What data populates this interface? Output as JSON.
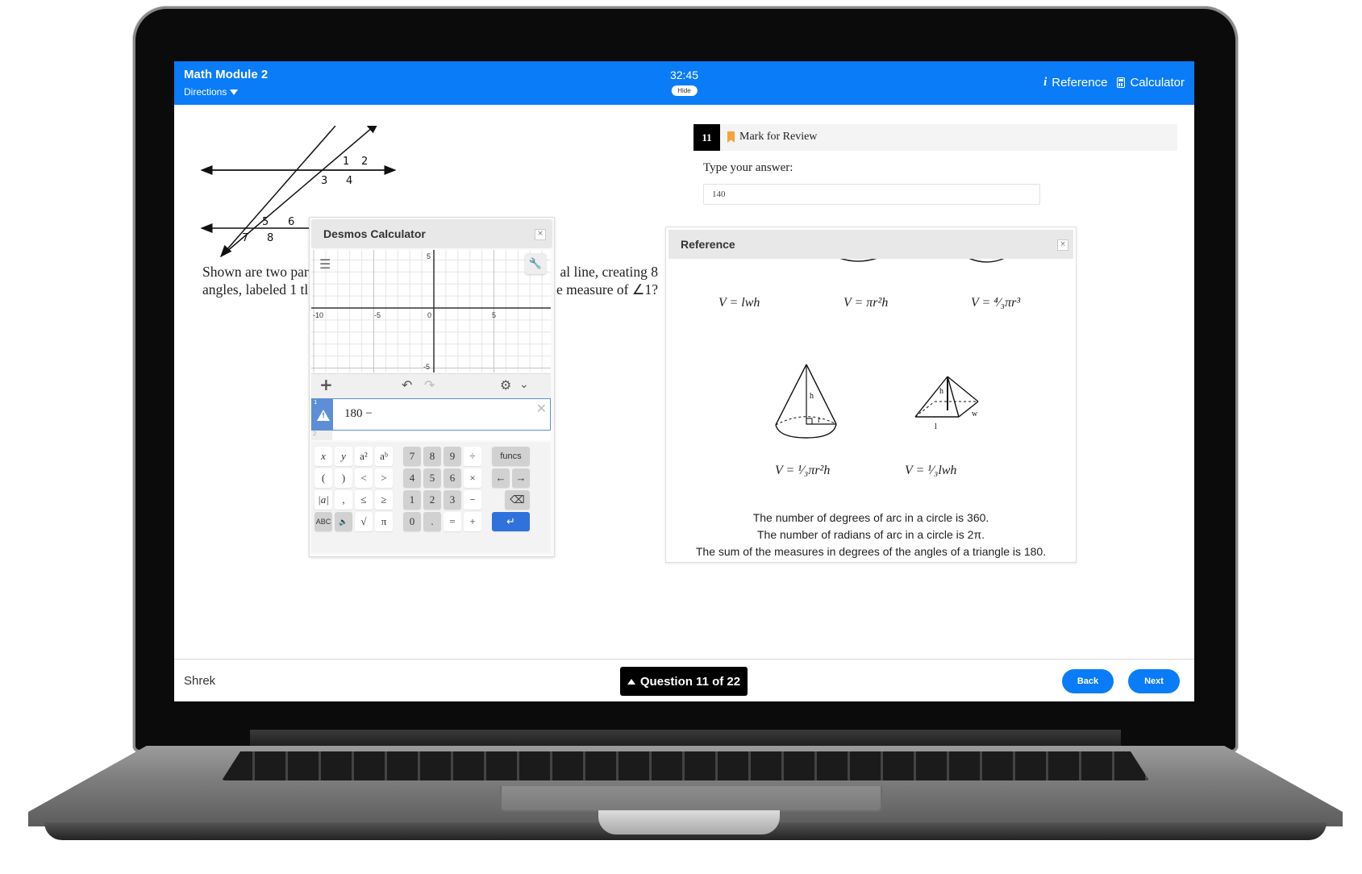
{
  "header": {
    "title": "Math Module 2",
    "directions_label": "Directions",
    "timer": "32:45",
    "hide_label": "Hide",
    "reference_label": "Reference",
    "calculator_label": "Calculator"
  },
  "question": {
    "figure_labels": [
      "1",
      "2",
      "3",
      "4",
      "5",
      "6",
      "7",
      "8"
    ],
    "text_line1_left": "Shown are two par",
    "text_line1_right": "al line, creating 8",
    "text_line2_left": "angles, labeled 1 tl",
    "text_line2_right": "e measure of ∠1?",
    "number": "11",
    "mark_for_review_label": "Mark for Review",
    "type_answer_label": "Type your answer:",
    "answer_value": "140"
  },
  "desmos": {
    "title": "Desmos Calculator",
    "close_label": "×",
    "graph": {
      "x_ticks": [
        "-10",
        "-5",
        "0",
        "5"
      ],
      "y_ticks": [
        "5",
        "-5"
      ]
    },
    "expressions": [
      {
        "index": "1",
        "text": "180 −",
        "status": "warning"
      },
      {
        "index": "2",
        "text": ""
      }
    ],
    "keypad": {
      "rows": [
        [
          "x",
          "y",
          "a²",
          "aᵇ",
          "7",
          "8",
          "9",
          "÷",
          "funcs"
        ],
        [
          "(",
          ")",
          "<",
          ">",
          "4",
          "5",
          "6",
          "×",
          "←",
          "→"
        ],
        [
          "|a|",
          ",",
          "≤",
          "≥",
          "1",
          "2",
          "3",
          "−",
          "⌫"
        ],
        [
          "ABC",
          "🔈",
          "√",
          "π",
          "0",
          ".",
          "=",
          "+",
          "↵"
        ]
      ]
    }
  },
  "reference": {
    "title": "Reference",
    "close_label": "×",
    "formulas_row1": [
      "V = lwh",
      "V = πr²h",
      "V = ⁴⁄₃πr³"
    ],
    "formulas_row2": [
      "V = ¹⁄₃πr²h",
      "V = ¹⁄₃lwh"
    ],
    "cone_labels": {
      "h": "h",
      "r": "r"
    },
    "pyramid_labels": {
      "h": "h",
      "l": "l",
      "w": "w"
    },
    "facts": [
      "The number of degrees of arc in a circle is 360.",
      "The number of radians of arc in a circle is 2π.",
      "The sum of the measures in degrees of the angles of a triangle is 180."
    ]
  },
  "footer": {
    "user_name": "Shrek",
    "question_nav_label": "Question 11 of 22",
    "back_label": "Back",
    "next_label": "Next"
  },
  "colors": {
    "brand_blue": "#0a7cf8",
    "bookmark_orange": "#f7a33a",
    "desmos_blue": "#2f72dc"
  }
}
